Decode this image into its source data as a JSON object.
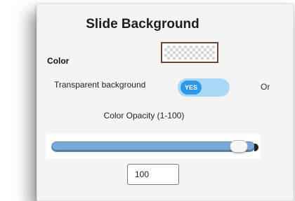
{
  "panel": {
    "title": "Slide Background",
    "color_label": "Color",
    "transparent_label": "Transparent background",
    "toggle_state": "YES",
    "or_label": "Or",
    "opacity_label": "Color Opacity (1-100)",
    "opacity_value": "100",
    "opacity_fraction": 1.0
  },
  "colors": {
    "toggle_on": "#2d98ea",
    "toggle_track": "#a8d8f6",
    "slider_fill": "#79a9d9",
    "swatch_border": "#6b4636"
  }
}
